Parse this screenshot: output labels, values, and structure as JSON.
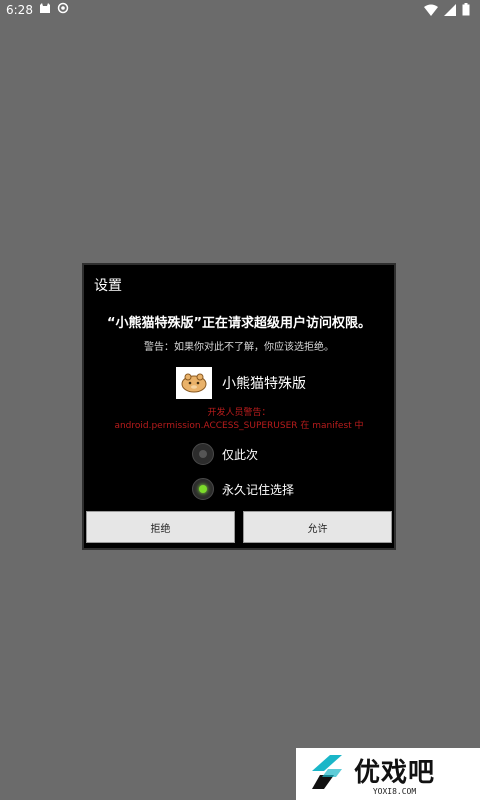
{
  "status_bar": {
    "time": "6:28",
    "icons_left": [
      "cat-icon",
      "circle-icon"
    ],
    "icons_right": [
      "wifi-icon",
      "signal-icon",
      "battery-icon"
    ]
  },
  "dialog": {
    "title": "设置",
    "heading": "“小熊猫特殊版”正在请求超级用户访问权限。",
    "warning": "警告：如果你对此不了解，你应该选拒绝。",
    "app_name": "小熊猫特殊版",
    "dev_warning_line1": "开发人员警告：",
    "dev_warning_line2": "android.permission.ACCESS_SUPERUSER 在 manifest 中",
    "options": [
      {
        "label": "仅此次",
        "selected": false
      },
      {
        "label": "永久记住选择",
        "selected": true
      }
    ],
    "deny_label": "拒绝",
    "allow_label": "允许"
  },
  "watermark": {
    "text": "优戏吧",
    "sub": "YOXI8.COM"
  },
  "colors": {
    "background": "#6b6b6b",
    "dialog_bg": "#000000",
    "warning_red": "#b71c1c",
    "radio_selected": "#7cdc2a",
    "button_bg": "#e6e6e6"
  }
}
